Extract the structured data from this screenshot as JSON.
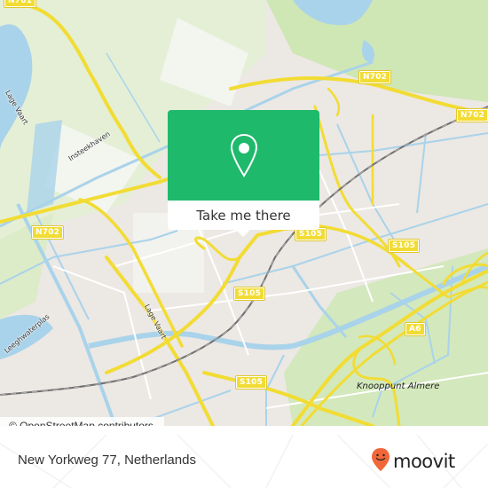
{
  "map": {
    "road_shields": [
      {
        "id": "n701",
        "label": "N701"
      },
      {
        "id": "n702_top",
        "label": "N702"
      },
      {
        "id": "n702_right",
        "label": "N702"
      },
      {
        "id": "n702_left",
        "label": "N702"
      },
      {
        "id": "s105_center",
        "label": "S105"
      },
      {
        "id": "s105_right",
        "label": "S105"
      },
      {
        "id": "s105_mid",
        "label": "S105"
      },
      {
        "id": "s105_bottom",
        "label": "S105"
      },
      {
        "id": "a6",
        "label": "A6"
      }
    ],
    "street_labels": {
      "lage_vaart_top": "Lage Vaart",
      "lage_vaart_mid": "Lage Vaart",
      "insteekhaven": "Insteekhaven",
      "leeghwaterplas": "Leeghwaterplas"
    },
    "place_labels": {
      "knooppunt": "Knooppunt Almere"
    },
    "colors": {
      "water": "#a9d3ea",
      "park": "#d3e8bc",
      "urban": "#ece8e4",
      "motorway": "#f2dc34",
      "rail": "#707070"
    }
  },
  "popup": {
    "button_label": "Take me there",
    "icon": "location-pin-icon",
    "color": "#1fb96b"
  },
  "attribution": "© OpenStreetMap contributors",
  "footer": {
    "address": "New Yorkweg 77, Netherlands",
    "brand": "moovit",
    "brand_color": "#f26739"
  }
}
